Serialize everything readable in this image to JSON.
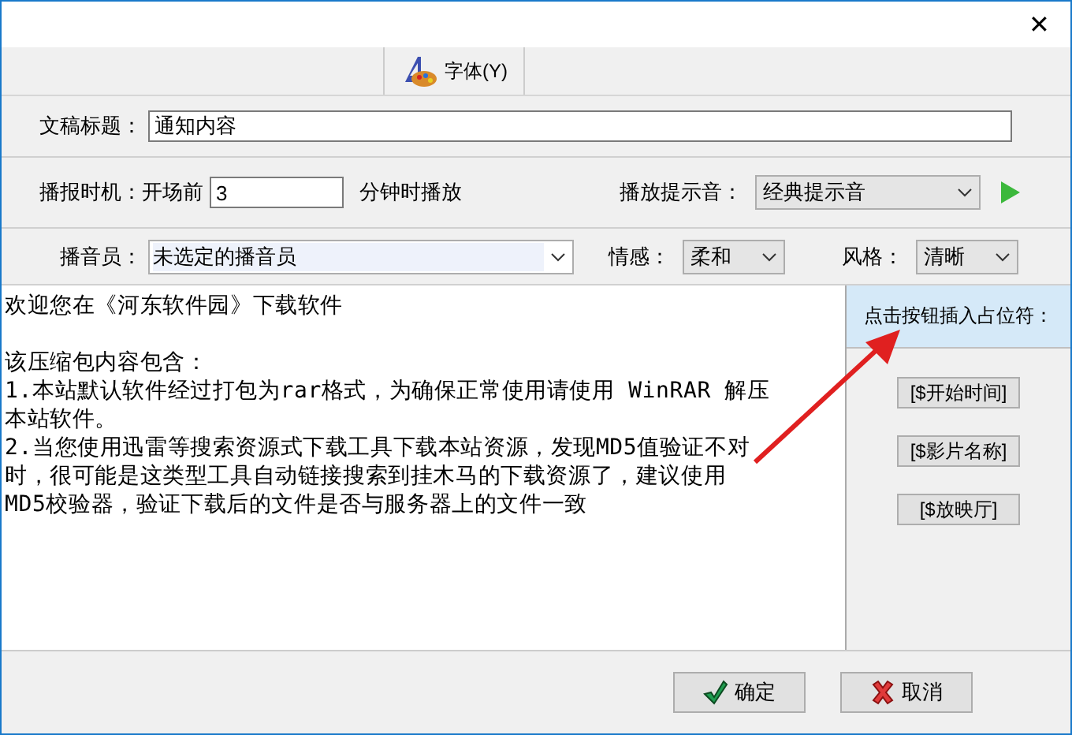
{
  "window": {
    "close": "✕"
  },
  "toolbar": {
    "font_button": "字体(Y)"
  },
  "title_row": {
    "label": "文稿标题：",
    "value": "通知内容"
  },
  "timing_row": {
    "label": "播报时机：开场前",
    "minutes": "3",
    "suffix": "分钟时播放",
    "sound_label": "播放提示音：",
    "sound": "经典提示音"
  },
  "voice_row": {
    "label": "播音员：",
    "announcer": "未选定的播音员",
    "emotion_label": "情感：",
    "emotion": "柔和",
    "style_label": "风格：",
    "style": "清晰"
  },
  "editor": {
    "paragraphs": [
      [
        "欢迎您在《河东软件园》下载软件"
      ],
      [
        "该压缩包内容包含：",
        "1.本站默认软件经过打包为rar格式，为确保正常使用请使用 WinRAR 解压",
        "本站软件。",
        "2.当您使用迅雷等搜索资源式下载工具下载本站资源，发现MD5值验证不对",
        "时，很可能是这类型工具自动链接搜索到挂木马的下载资源了，建议使用",
        "MD5校验器，验证下载后的文件是否与服务器上的文件一致"
      ]
    ]
  },
  "placeholders": {
    "header": "点击按钮插入占位符：",
    "buttons": [
      "[$开始时间]",
      "[$影片名称]",
      "[$放映厅]"
    ]
  },
  "buttons": [
    {
      "kind": "ok",
      "label": "确定"
    },
    {
      "kind": "cancel",
      "label": "取消"
    }
  ]
}
